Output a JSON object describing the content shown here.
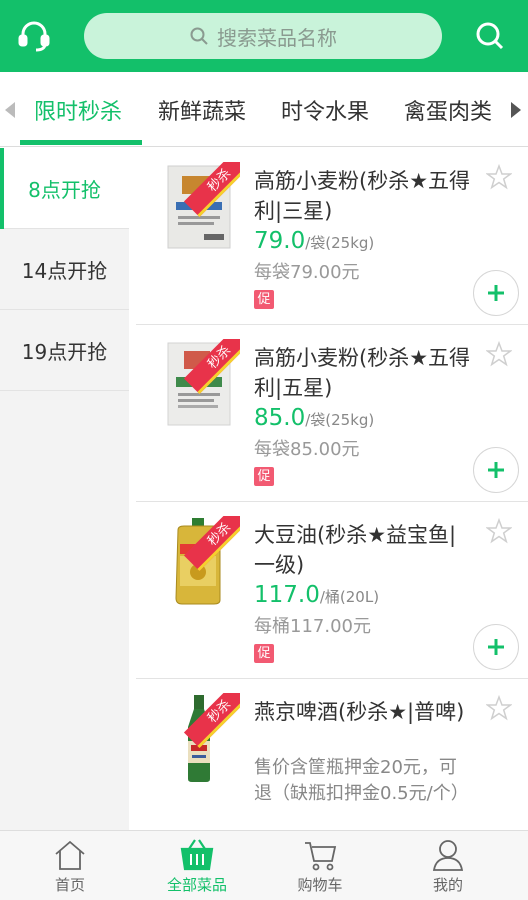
{
  "header": {
    "search_placeholder": "搜索菜品名称",
    "left_icon": "headset-icon",
    "right_icon": "search-icon"
  },
  "categories": [
    "限时秒杀",
    "新鲜蔬菜",
    "时令水果",
    "禽蛋肉类"
  ],
  "active_category": "限时秒杀",
  "time_slots": [
    "8点开抢",
    "14点开抢",
    "19点开抢"
  ],
  "active_time_slot": "8点开抢",
  "products": [
    {
      "name": "高筋小麦粉(秒杀★五得利|三星)",
      "badge": "秒杀",
      "price": "79.0",
      "unit": "/袋(25kg)",
      "unit_price": "每袋79.00元",
      "promo_tag": "促"
    },
    {
      "name": "高筋小麦粉(秒杀★五得利|五星)",
      "badge": "秒杀",
      "price": "85.0",
      "unit": "/袋(25kg)",
      "unit_price": "每袋85.00元",
      "promo_tag": "促"
    },
    {
      "name": "大豆油(秒杀★益宝鱼|一级)",
      "badge": "秒杀",
      "price": "117.0",
      "unit": "/桶(20L)",
      "unit_price": "每桶117.00元",
      "promo_tag": "促"
    },
    {
      "name": "燕京啤酒(秒杀★|普啤)",
      "badge": "秒杀",
      "note": "售价含筐瓶押金20元，可退（缺瓶扣押金0.5元/个）"
    }
  ],
  "bottom_nav": [
    {
      "label": "首页",
      "icon": "home-icon"
    },
    {
      "label": "全部菜品",
      "icon": "basket-icon"
    },
    {
      "label": "购物车",
      "icon": "cart-icon"
    },
    {
      "label": "我的",
      "icon": "user-icon"
    }
  ],
  "active_nav": "全部菜品",
  "colors": {
    "brand_green": "#13c06a",
    "search_bg": "#c9f3da",
    "promo_red": "#f25a72",
    "ribbon_red": "#e8334a"
  }
}
